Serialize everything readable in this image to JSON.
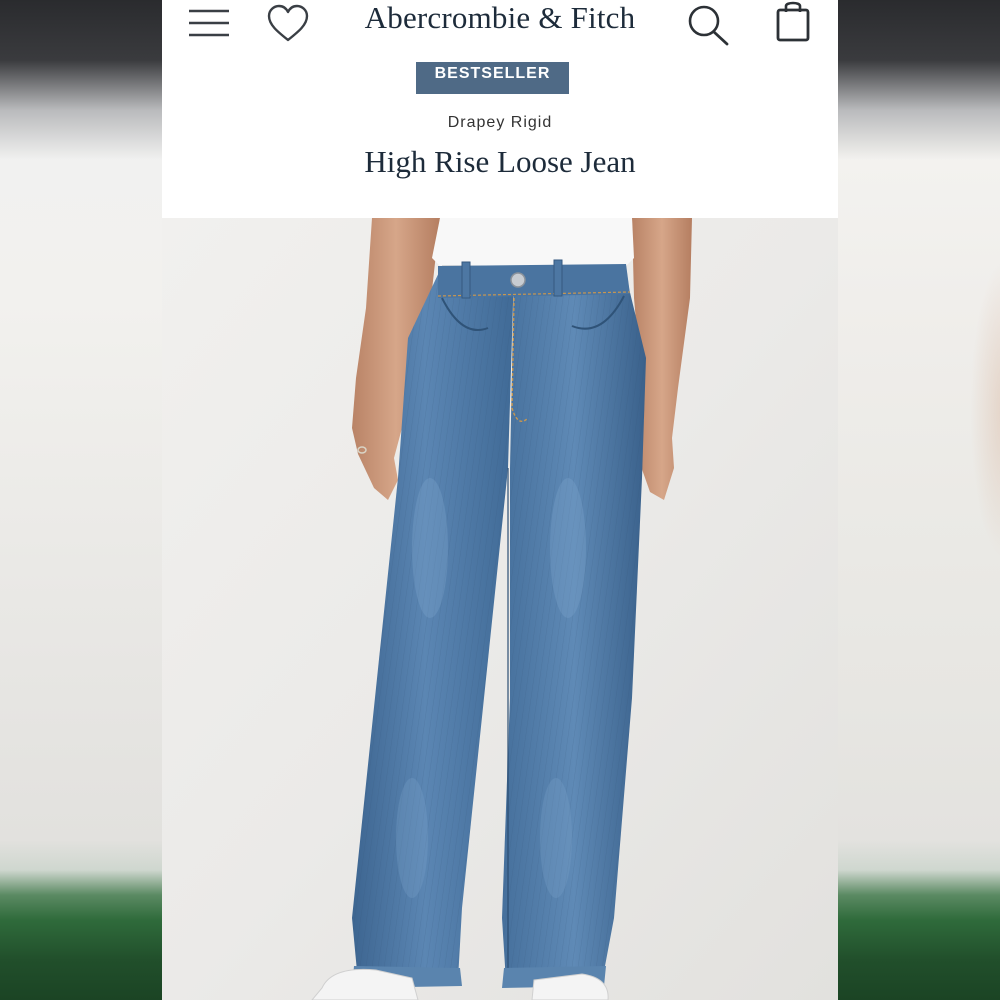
{
  "header": {
    "brand": "Abercrombie & Fitch",
    "icons": [
      "menu-icon",
      "heart-icon",
      "search-icon",
      "shopping-bag-icon"
    ]
  },
  "product": {
    "badge": "BESTSELLER",
    "fit": "Drapey Rigid",
    "name": "High Rise Loose Jean"
  },
  "colors": {
    "brand_text": "#1d2b3a",
    "badge_bg": "#4f6a86",
    "denim": "#4f79a6"
  }
}
